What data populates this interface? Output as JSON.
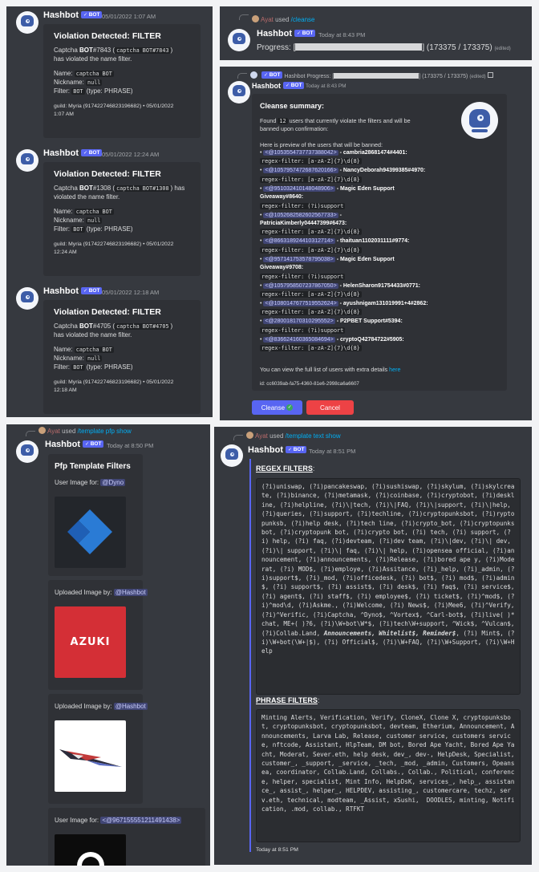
{
  "bot_name": "Hashbot",
  "bot_badge": "BOT",
  "panel1": {
    "messages": [
      {
        "time": "05/01/2022 1:07 AM",
        "title": "Violation Detected: FILTER",
        "line1a": "Captcha ",
        "line1b": "BOT",
        "line1c": "#7843 (",
        "line1code": "captcha BOT#7843",
        "line1d": ")",
        "line2": "has violated the name filter.",
        "name_label": "Name: ",
        "name_code": "captcha BOT",
        "nick_label": "Nickname: ",
        "nick_code": "null",
        "filter_label": "Filter: ",
        "filter_code": "BOT",
        "filter_type": " (type: PHRASE)",
        "footer1": "guild: Myria (917422746823196682) • 05/01/2022",
        "footer2": "1:07 AM"
      },
      {
        "time": "05/01/2022 12:24 AM",
        "title": "Violation Detected: FILTER",
        "line1a": "Captcha ",
        "line1b": "BOT",
        "line1c": "#1308 (",
        "line1code": "captcha BOT#1308",
        "line1d": ") has",
        "line2": "violated the name filter.",
        "name_label": "Name: ",
        "name_code": "captcha BOT",
        "nick_label": "Nickname: ",
        "nick_code": "null",
        "filter_label": "Filter: ",
        "filter_code": "BOT",
        "filter_type": " (type: PHRASE)",
        "footer1": "guild: Myria (917422746823196682) • 05/01/2022",
        "footer2": "12:24 AM"
      },
      {
        "time": "05/01/2022 12:18 AM",
        "title": "Violation Detected: FILTER",
        "line1a": "Captcha ",
        "line1b": "BOT",
        "line1c": "#4705 (",
        "line1code": "captcha BOT#4705",
        "line1d": ")",
        "line2": "has violated the name filter.",
        "name_label": "Name: ",
        "name_code": "captcha BOT",
        "nick_label": "Nickname: ",
        "nick_code": "null",
        "filter_label": "Filter: ",
        "filter_code": "BOT",
        "filter_type": " (type: PHRASE)",
        "footer1": "guild: Myria (917422746823196682) • 05/01/2022",
        "footer2": "12:18 AM"
      }
    ]
  },
  "panel2": {
    "reply_user": "Ayat",
    "reply_used": " used ",
    "reply_cmd": "/cleanse",
    "time": "Today at 8:43 PM",
    "progress_label": "Progress: ",
    "progress_open": "[",
    "progress_close": "]",
    "progress_value": 1,
    "progress_count": "(173375 / 173375)",
    "edited": "(edited)"
  },
  "panel3": {
    "reply_text": "Hashbot Progress: [",
    "reply_count": "] (173375 / 173375)",
    "reply_edited": "(edited)",
    "time": "Today at 8:43 PM",
    "title": "Cleanse summary:",
    "found_a": "Found ",
    "found_code": "12",
    "found_b": " users that currently violate the filters and will be",
    "found_c": "banned upon confirmation:",
    "preview": "Here is preview of the users that will be banned:",
    "bullet": "•",
    "users": [
      {
        "id": "<@1053554737737388042>",
        "name": " - cambria28681474#4401:",
        "filter": "regex-filter: [a-zA-Z]{7}\\d{8}"
      },
      {
        "id": "<@1057957472687620166>",
        "name": " - NancyDeborah94399385#4970:",
        "filter": "regex-filter: [a-zA-Z]{7}\\d{8}"
      },
      {
        "id": "<@951032410148048906>",
        "name": " - Magic Eden Support",
        "name2": "Giveaway#8640:",
        "filter": "regex-filter: (?i)support"
      },
      {
        "id": "<@1052682582602567733>",
        "name": " -",
        "name2": "PatriciaKimberly04447399#6473:",
        "filter": "regex-filter: [a-zA-Z]{7}\\d{8}"
      },
      {
        "id": "<@866318924410312714>",
        "name": " - thaituan1102031111#9774:",
        "filter": "regex-filter: [a-zA-Z]{7}\\d{8}"
      },
      {
        "id": "<@957141753578795038>",
        "name": " - Magic Eden Support",
        "name2": "Giveaway#9708:",
        "filter": "regex-filter: (?i)support"
      },
      {
        "id": "<@1057958507237867050>",
        "name": " - HelenSharon91754433#0771:",
        "filter": "regex-filter: [a-zA-Z]{7}\\d{8}"
      },
      {
        "id": "<@1080147677519552624>",
        "name": " - ayushnigam131019991+4#2862:",
        "filter": "regex-filter: [a-zA-Z]{7}\\d{8}"
      },
      {
        "id": "<@280018170310295552>",
        "name": " - P2PBET Support#5394:",
        "filter": "regex-filter: (?i)support"
      },
      {
        "id": "<@836624160365084694>",
        "name": " - cryptoQ42784722#5905:",
        "filter": "regex-filter: [a-zA-Z]{7}\\d{8}"
      }
    ],
    "full_list_a": "You can view the full list of users with extra details ",
    "full_list_link": "here",
    "id_line": "id: cc6039ab-fa75-4360-81e6-2998ca6a6607",
    "cleanse_btn": "Cleanse",
    "cancel_btn": "Cancel"
  },
  "panel4": {
    "reply_user": "Ayat",
    "reply_used": " used ",
    "reply_cmd": "/template pfp show",
    "time": "Today at 8:50 PM",
    "title": "Pfp Template Filters",
    "e1_label": "User Image for: ",
    "e1_mention": "@Dyno",
    "e2_label": "Uploaded Image by: ",
    "e2_mention": "@Hashbot",
    "e2_text": "AZUKI",
    "e3_label": "Uploaded Image by: ",
    "e3_mention": "@Hashbot",
    "e4_label": "User Image for: ",
    "e4_mention": "<@967155551211491438>"
  },
  "panel5": {
    "reply_user": "Ayat",
    "reply_used": " used ",
    "reply_cmd": "/template text show",
    "time": "Today at 8:51 PM",
    "regex_title": "REGEX FILTERS",
    "colon": ":",
    "regex_body": "(?i)uniswap, (?i)pancakeswap, (?i)sushiswap, (?i)skylum, (?i)skylcreate, (?i)binance, (?i)metamask, (?i)coinbase, (?i)cryptobot, (?i)deskline, (?i)helpline, (?i)\\|tech, (?i)\\|FAQ, (?i)\\|support, (?i)\\|help, (?i)queries, (?i)support, (?i)techline, (?i)cryptopunksbot, (?i)ryptopunksb, (?i)help desk, (?i)tech line, (?i)crypto_bot, (?i)cryptopunks bot, (?i)cryptopunk bot, (?i)crypto bot, (?i) tech, (?i) support, (?i) help, (?i) faq, (?i)devteam, (?i)dev team, (?i)\\|dev, (?i)\\| dev, (?i)\\| support, (?i)\\| faq, (?i)\\| help, (?i)opensea official, (?i)announcement, (?i)announcements, (?i)Release, (?i)bored ape y, (?i)Moderat, (?i) MOD$, (?i)employe, (?i)Assitance, (?i)_help, (?i)_admin, (?i)support$, (?i)_mod, (?i)officedesk, (?i) bot$, (?i) mod$, (?i)admin$, (?i) support$, (?i) assist$, (?i) desk$, (?i) faq$, (?i) service$, (?i) agent$, (?i) staff$, (?i) employee$, (?i) ticket$, (?i)^mod$, (?i)^mod\\d, (?i)Askme., (?i)Welcome, (?i) News$, (?i)Mee6, (?i)^Verify, (?i)^Verific, (?i)Captcha, ^Dyno$, ^Vortex$, ^Carl-bot$, (?i)live( )*chat, ME+( )?6, (?i)\\W+bot\\W*$, (?i)tech\\W+support, ^Wick$, ^Vulcan$, (?i)Collab.Land, ",
    "regex_italic": "Announcements, Whitelist$, Reminder$",
    "regex_tail": ", (?i) Mint$, (?i)\\W+bot(\\W+|$), (?i) Official$, (?i)\\W+FAQ, (?i)\\W+Support, (?i)\\W+Help",
    "phrase_title": "PHRASE FILTERS",
    "phrase_body": "Minting Alerts, Verification, Verify, CloneX, Clone X, cryptopunksbot, cryptopunksbot, cryptopunksbot, devteam, Etherium, Announcement, Announcements, Larva Lab, Release, customer service, customers service, nftcode, Assistant, HlpTeam, DM bot, Bored Ape Yacht, Bored Ape Yacht, Moderat, Sever.eth, help desk, dev_, dev-, HelpDesk, Specialist, customer_, _support, _service, _tech, _mod, _admin, Customers, Opeansea, coordinator, Collab.Land, Collabs., Collab., Political, conference, helper, specialist, Mint Info, HelpDsK, services_, help_, assistance_, assist_, helper_, HELPDEV, assisting_, customercare, techz, serv.eth, technical, modteam, _Assist, xSushi,  DOODLES, minting, Notification, .mod, collab., RTFKT",
    "footer": "Today at 8:51 PM"
  }
}
